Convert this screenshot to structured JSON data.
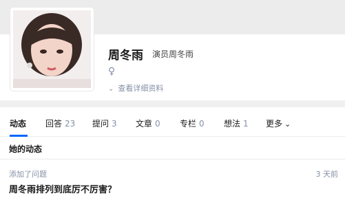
{
  "profile": {
    "name": "周冬雨",
    "headline": "演员周冬雨",
    "gender_icon": "female-icon",
    "view_details": "查看详细资料"
  },
  "tabs": [
    {
      "label": "动态",
      "count": ""
    },
    {
      "label": "回答",
      "count": "23"
    },
    {
      "label": "提问",
      "count": "3"
    },
    {
      "label": "文章",
      "count": "0"
    },
    {
      "label": "专栏",
      "count": "0"
    },
    {
      "label": "想法",
      "count": "1"
    },
    {
      "label": "更多",
      "count": ""
    }
  ],
  "section_title": "她的动态",
  "feed": [
    {
      "action": "添加了问题",
      "time": "3 天前",
      "title": "周冬雨排列到底厉不厉害？"
    }
  ],
  "colors": {
    "accent": "#0066ff",
    "meta": "#8590a6"
  }
}
